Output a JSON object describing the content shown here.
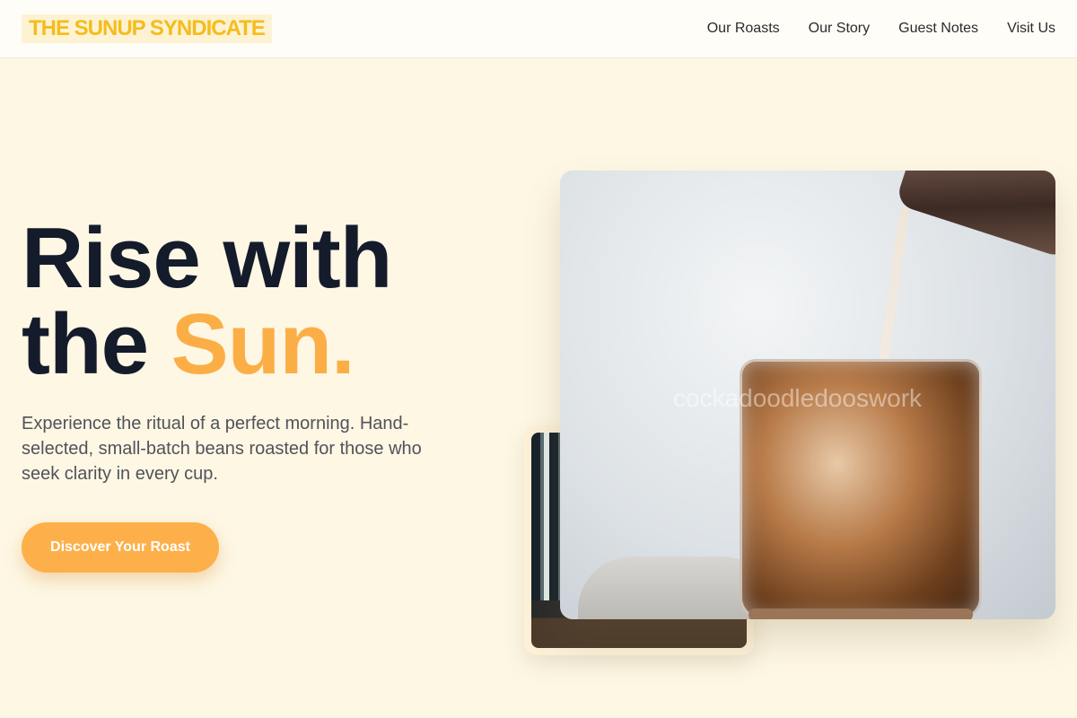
{
  "header": {
    "logo": "THE SUNUP SYNDICATE",
    "nav": [
      {
        "label": "Our Roasts"
      },
      {
        "label": "Our Story"
      },
      {
        "label": "Guest Notes"
      },
      {
        "label": "Visit Us"
      }
    ]
  },
  "hero": {
    "headline_line1": "Rise with",
    "headline_the": "the ",
    "headline_accent": "Sun.",
    "subtitle": "Experience the ritual of a perfect morning. Hand-selected, small-batch beans roasted for those who seek clarity in every cup.",
    "cta_label": "Discover Your Roast"
  },
  "images": {
    "main_watermark": "cockadoodledooswork"
  },
  "colors": {
    "background": "#fdf7e4",
    "accent": "#fdb04a",
    "logo": "#f5bc1c",
    "headline": "#141b2b"
  }
}
